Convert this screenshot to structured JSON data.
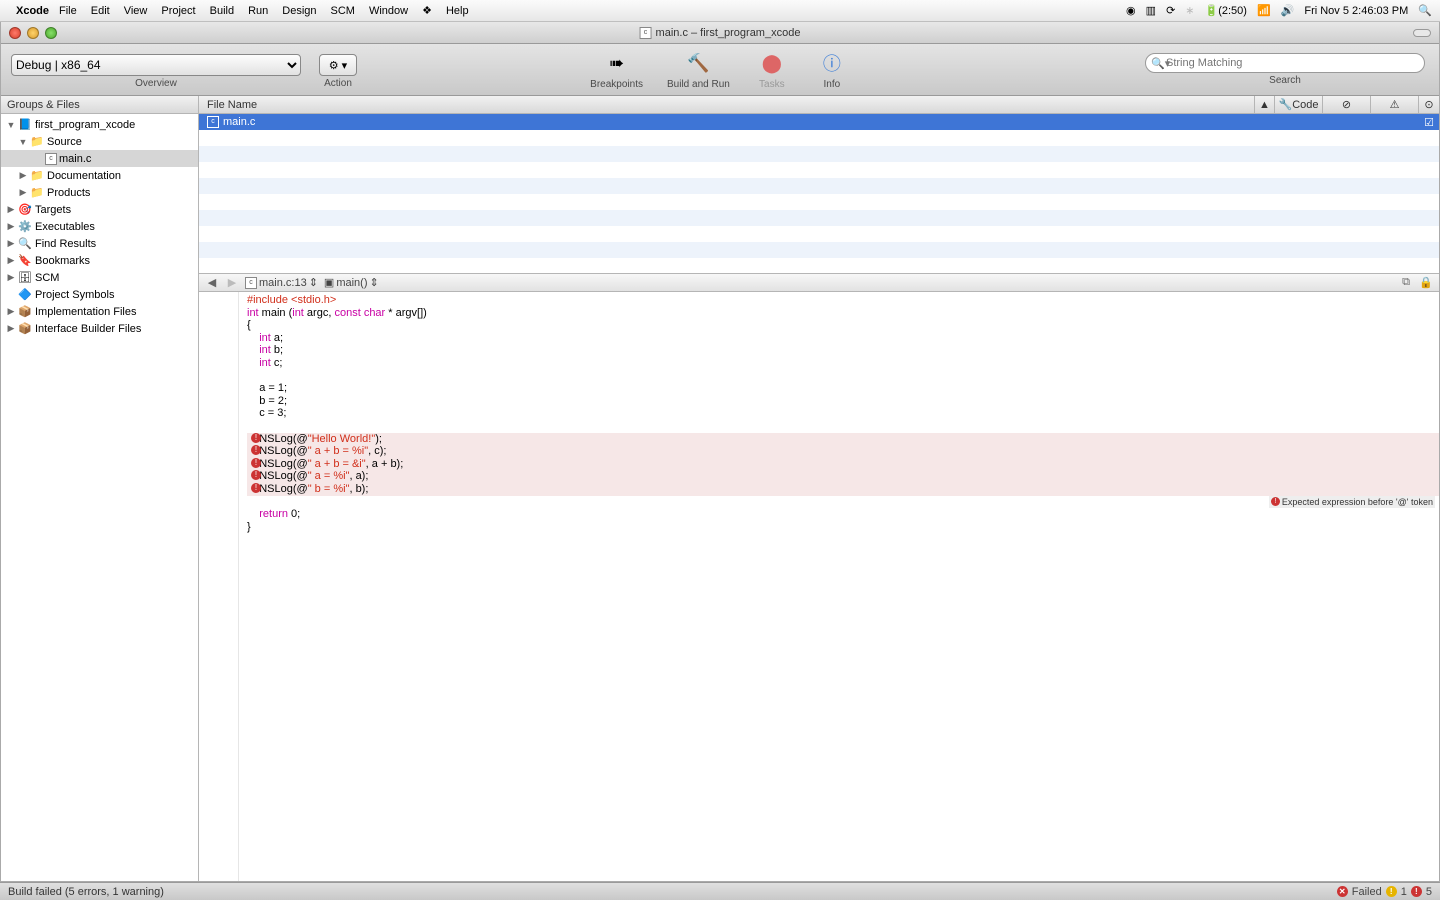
{
  "menubar": {
    "app": "Xcode",
    "items": [
      "File",
      "Edit",
      "View",
      "Project",
      "Build",
      "Run",
      "Design",
      "SCM",
      "Window",
      "Help"
    ],
    "status": {
      "battery": "(2:50)",
      "clock": "Fri Nov 5  2:46:03 PM"
    }
  },
  "window": {
    "title": "main.c – first_program_xcode"
  },
  "toolbar": {
    "config": "Debug | x86_64",
    "overview_label": "Overview",
    "action_label": "Action",
    "breakpoints": "Breakpoints",
    "buildrun": "Build and Run",
    "tasks": "Tasks",
    "info": "Info",
    "search_placeholder": "String Matching",
    "search_label": "Search"
  },
  "sidebar": {
    "header": "Groups & Files",
    "tree": [
      {
        "label": "first_program_xcode",
        "depth": 0,
        "arrow": "down",
        "icon": "📘"
      },
      {
        "label": "Source",
        "depth": 1,
        "arrow": "down",
        "icon": "📁"
      },
      {
        "label": "main.c",
        "depth": 2,
        "arrow": "",
        "icon": "c",
        "selected": true
      },
      {
        "label": "Documentation",
        "depth": 1,
        "arrow": "right",
        "icon": "📁"
      },
      {
        "label": "Products",
        "depth": 1,
        "arrow": "right",
        "icon": "📁"
      },
      {
        "label": "Targets",
        "depth": 0,
        "arrow": "right",
        "icon": "🎯"
      },
      {
        "label": "Executables",
        "depth": 0,
        "arrow": "right",
        "icon": "⚙️"
      },
      {
        "label": "Find Results",
        "depth": 0,
        "arrow": "right",
        "icon": "🔍"
      },
      {
        "label": "Bookmarks",
        "depth": 0,
        "arrow": "right",
        "icon": "🔖"
      },
      {
        "label": "SCM",
        "depth": 0,
        "arrow": "right",
        "icon": "🗄"
      },
      {
        "label": "Project Symbols",
        "depth": 0,
        "arrow": "",
        "icon": "🔷"
      },
      {
        "label": "Implementation Files",
        "depth": 0,
        "arrow": "right",
        "icon": "📦"
      },
      {
        "label": "Interface Builder Files",
        "depth": 0,
        "arrow": "right",
        "icon": "📦"
      }
    ]
  },
  "filelist": {
    "headers": {
      "name": "File Name",
      "code": "Code"
    },
    "rows": [
      {
        "name": "main.c",
        "selected": true,
        "checked": true
      }
    ],
    "blank_rows": 8
  },
  "navbar": {
    "crumb1": "main.c:13",
    "crumb2": "main()"
  },
  "code": {
    "lines": [
      {
        "t": "include",
        "raw": "#include <stdio.h>"
      },
      {
        "t": "blank",
        "raw": ""
      },
      {
        "t": "sig",
        "raw": "int main (int argc, const char * argv[])"
      },
      {
        "t": "plain",
        "raw": "{"
      },
      {
        "t": "decl",
        "raw": "    int a;"
      },
      {
        "t": "decl",
        "raw": "    int b;"
      },
      {
        "t": "decl",
        "raw": "    int c;"
      },
      {
        "t": "blank",
        "raw": "    "
      },
      {
        "t": "plain",
        "raw": "    a = 1;"
      },
      {
        "t": "plain",
        "raw": "    b = 2;"
      },
      {
        "t": "plain",
        "raw": "    c = 3;"
      },
      {
        "t": "blank",
        "raw": "    "
      },
      {
        "t": "err",
        "raw": "    NSLog(@\"Hello World!\");",
        "msg": "Expected expression before '@' token",
        "count": 2
      },
      {
        "t": "err",
        "raw": "    NSLog(@\" a + b = %i\", c);",
        "msg": "Expected expression before '@' token"
      },
      {
        "t": "err",
        "raw": "    NSLog(@\" a + b = &i\", a + b);",
        "msg": "Expected expression before '@' token"
      },
      {
        "t": "err",
        "raw": "    NSLog(@\" a = %i\", a);",
        "msg": "Expected expression before '@' token"
      },
      {
        "t": "err",
        "raw": "    NSLog(@\" b = %i\", b);",
        "msg": "Expected expression before '@' token"
      },
      {
        "t": "blank",
        "raw": "    "
      },
      {
        "t": "ret",
        "raw": "    return 0;"
      },
      {
        "t": "plain",
        "raw": "}"
      }
    ]
  },
  "statusbar": {
    "msg": "Build failed (5 errors, 1 warning)",
    "failed": "Failed",
    "warn_count": "1",
    "err_count": "5"
  }
}
